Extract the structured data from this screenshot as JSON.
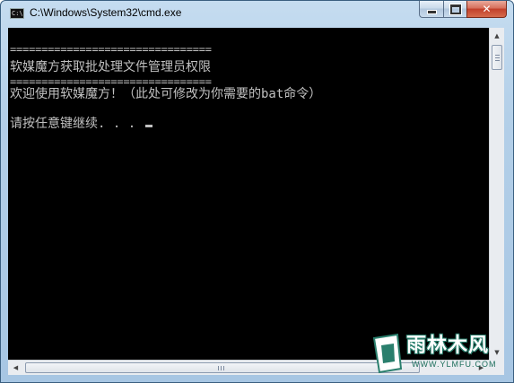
{
  "window": {
    "title": "C:\\Windows\\System32\\cmd.exe",
    "icon": "cmd-console-icon",
    "icon_text": "C:\\",
    "buttons": {
      "minimize": "minimize-icon",
      "maximize": "maximize-icon",
      "close_glyph": "✕"
    }
  },
  "console": {
    "background": "#000000",
    "foreground": "#c0c0c0",
    "lines": [
      "================================",
      "软媒魔方获取批处理文件管理员权限",
      "================================",
      "欢迎使用软媒魔方！（此处可修改为你需要的bat命令）",
      "请按任意键继续. . . "
    ]
  },
  "scrollbars": {
    "up_arrow": "▲",
    "down_arrow": "▼",
    "left_arrow": "◀",
    "right_arrow": "▶"
  },
  "watermark": {
    "logo_text": "雨林木风",
    "url": "WWW.YLMFU.COM",
    "color": "#2a7f6d"
  }
}
